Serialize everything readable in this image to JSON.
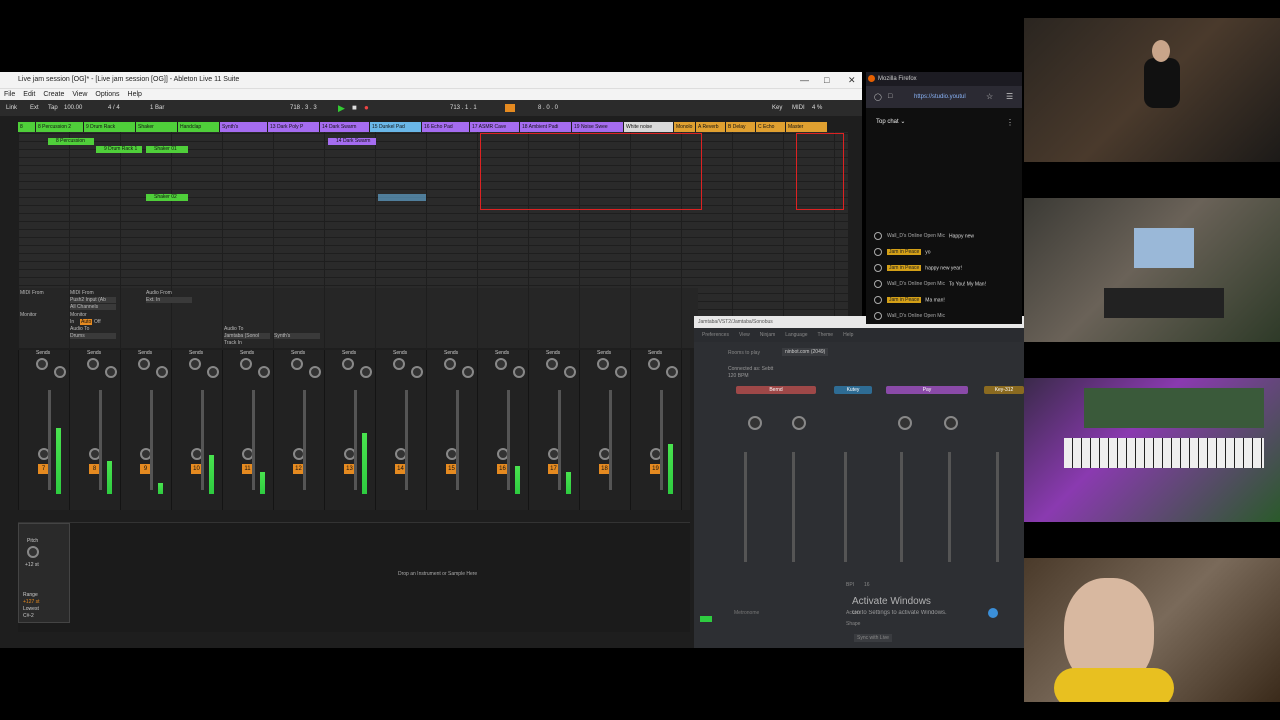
{
  "ableton": {
    "title": "Live jam session [OG]* - [Live jam session [OG]] - Ableton Live 11 Suite",
    "menu": [
      "File",
      "Edit",
      "Create",
      "View",
      "Options",
      "Help"
    ],
    "transport": {
      "link": "Link",
      "ext": "Ext",
      "tap": "Tap",
      "tempo": "100.00",
      "signature": "4 / 4",
      "quantize": "1 Bar",
      "position": "718 . 3 . 3",
      "loop_start": "713 . 1 . 1",
      "loop_length": "8 . 0 . 0",
      "key": "Key",
      "midi": "MIDI",
      "cpu": "4 %"
    },
    "tracks": [
      {
        "name": "8",
        "color": "#4fcf3a"
      },
      {
        "name": "8 Percussion 2",
        "color": "#4fcf3a"
      },
      {
        "name": "9 Drum Rack",
        "color": "#4fcf3a"
      },
      {
        "name": "Shaker",
        "color": "#4fcf3a"
      },
      {
        "name": "Handclap",
        "color": "#4fcf3a"
      },
      {
        "name": "Synth's",
        "color": "#a56cf0"
      },
      {
        "name": "13 Dark Poly P",
        "color": "#a56cf0"
      },
      {
        "name": "14 Dark Swarm",
        "color": "#a56cf0"
      },
      {
        "name": "15 Dunkel Pad",
        "color": "#6ab7e8"
      },
      {
        "name": "16 Echo Pad",
        "color": "#a56cf0"
      },
      {
        "name": "17 ASMR Cave",
        "color": "#a56cf0"
      },
      {
        "name": "18 Ambient Padi",
        "color": "#a56cf0"
      },
      {
        "name": "19 Noise Swee",
        "color": "#a56cf0"
      },
      {
        "name": "White noise",
        "color": "#d9d9d9"
      },
      {
        "name": "Monolo",
        "color": "#e0a030"
      },
      {
        "name": "A Reverb",
        "color": "#e0a030"
      },
      {
        "name": "B Delay",
        "color": "#e0a030"
      },
      {
        "name": "C Echo",
        "color": "#e0a030"
      },
      {
        "name": "Master",
        "color": "#e0a030"
      }
    ],
    "clips": [
      {
        "label": "8 Percussion",
        "color": "#4fcf3a"
      },
      {
        "label": "9 Drum Rack 1",
        "color": "#4fcf3a"
      },
      {
        "label": "Shaker 01",
        "color": "#4fcf3a"
      },
      {
        "label": "Shaker 02",
        "color": "#4fcf3a"
      },
      {
        "label": "14 Dark Swarm",
        "color": "#a56cf0"
      }
    ],
    "io_labels": {
      "midi_from": "MIDI From",
      "audio_from": "Audio From",
      "push2": "Push2 Input (Ab",
      "all_channels": "All Channels",
      "ext_in": "Ext. In",
      "monitor": "Monitor",
      "in": "In",
      "auto": "Auto",
      "off": "Off",
      "audio_to": "Audio To",
      "drums": "Drums",
      "synths": "Synth's",
      "track_in": "Track In",
      "jamtaba": "Jamtaba (Sonol"
    },
    "mixer_numbers": [
      "7",
      "8",
      "9",
      "10",
      "11",
      "12",
      "13",
      "14",
      "15",
      "16",
      "17",
      "18",
      "19",
      "20"
    ],
    "sends_label": "Sends",
    "device": {
      "pitch_label": "Pitch",
      "pitch_value": "+12 st",
      "range_label": "Range",
      "range_value": "+127 st",
      "lowest_label": "Lowest",
      "lowest_value": "C#-2",
      "drop_hint": "Drop an Instrument or Sample Here"
    }
  },
  "sonobus": {
    "title": "Jamtaba/VST2/Jamtaba/Sonobus",
    "menu": [
      "Preferences",
      "View",
      "Ninjam",
      "Language",
      "Theme",
      "Help"
    ],
    "rooms": "Rooms to play",
    "server": "ninbot.com (2049)",
    "connected": "Connected as: Sebtt",
    "bpm": "120 BPM",
    "peers": [
      {
        "name": "Bernd",
        "color": "#e06060"
      },
      {
        "name": "Kutey",
        "color": "#4aa0d8"
      },
      {
        "name": "Pay",
        "color": "#c070e0"
      },
      {
        "name": "Key-312",
        "color": "#d0a030"
      }
    ],
    "bpi_label": "BPI",
    "bpi_value": "16",
    "accent_label": "Accent",
    "shape_label": "Shape",
    "sync_label": "Sync with Live",
    "metronome_label": "Metronome"
  },
  "windows": {
    "activate_title": "Activate Windows",
    "activate_sub": "Go to Settings to activate Windows."
  },
  "firefox": {
    "title": "Mozilla Firefox",
    "url": "https://studio.youtul",
    "top_chat": "Top chat",
    "messages": [
      {
        "user": "Wall_D's Online Open Mic",
        "text": "Happy new",
        "highlight": false
      },
      {
        "user": "Jam in Peace",
        "text": "yo",
        "highlight": true
      },
      {
        "user": "Jam in Peace",
        "text": "happy new year!",
        "highlight": true
      },
      {
        "user": "Wall_D's Online Open Mic",
        "text": "To You! My Man!",
        "highlight": false
      },
      {
        "user": "Jam in Peace",
        "text": "Ma man!",
        "highlight": true
      },
      {
        "user": "Wall_D's Online Open Mic",
        "text": "",
        "highlight": false
      }
    ]
  }
}
